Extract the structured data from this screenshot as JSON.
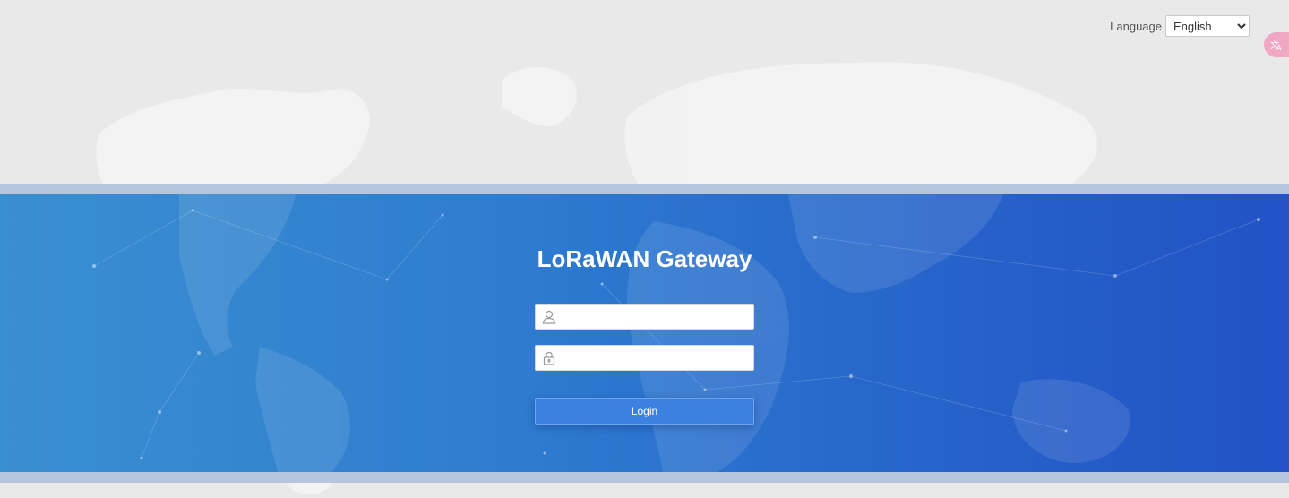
{
  "header": {
    "language_label": "Language",
    "language_selected": "English",
    "language_options": [
      "English"
    ],
    "translate_icon": "translate-icon"
  },
  "login": {
    "title": "LoRaWAN Gateway",
    "username_value": "",
    "password_value": "",
    "username_icon": "user-icon",
    "password_icon": "lock-icon",
    "button_label": "Login"
  },
  "colors": {
    "band_start": "#3a8fd0",
    "band_end": "#2252c6",
    "button": "#3b82e0",
    "page_bg": "#e9e9e9"
  }
}
